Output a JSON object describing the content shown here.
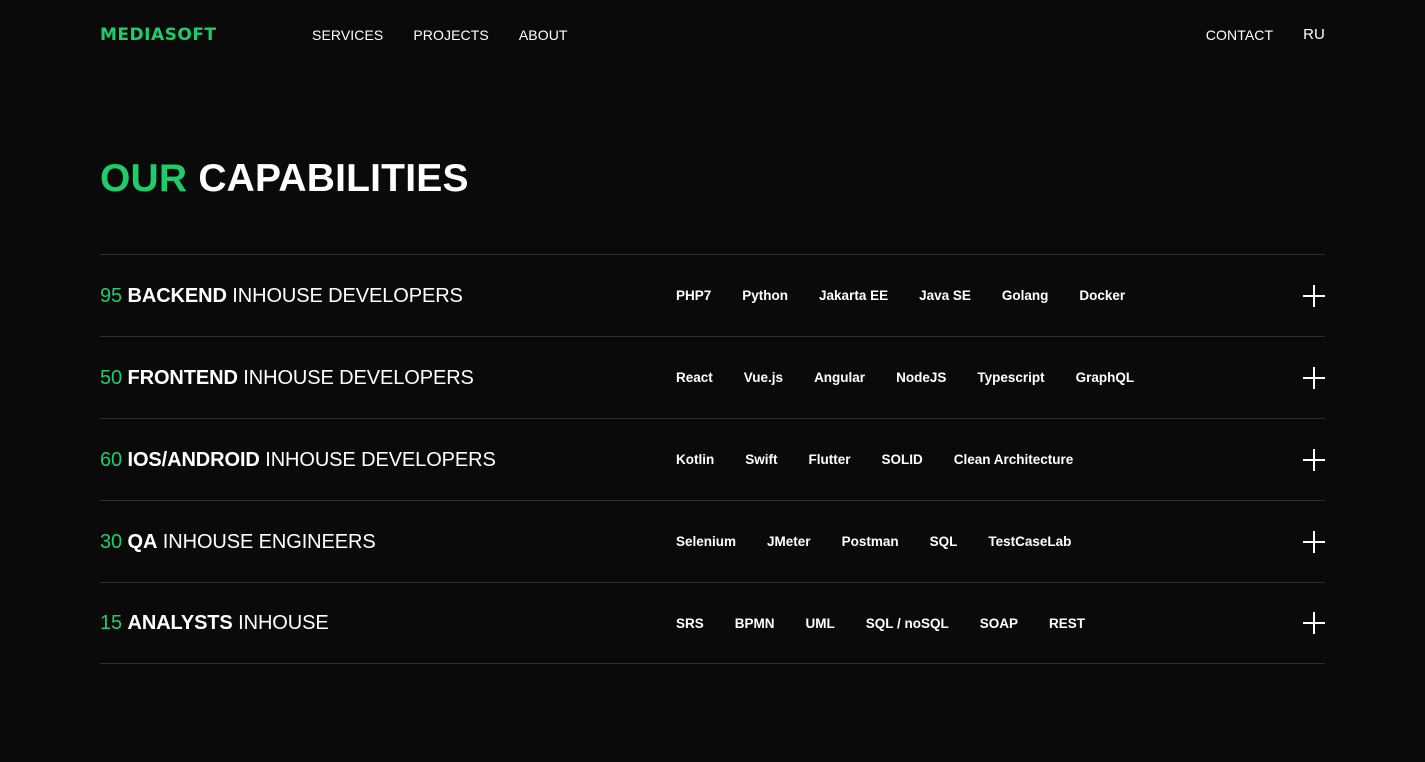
{
  "header": {
    "logo": "MEDIASOFT",
    "nav": [
      "SERVICES",
      "PROJECTS",
      "ABOUT"
    ],
    "contact": "CONTACT",
    "lang": "RU"
  },
  "section": {
    "title_accent": "OUR",
    "title_rest": "CAPABILITIES"
  },
  "capabilities": [
    {
      "count": "95",
      "bold": "BACKEND",
      "rest": "INHOUSE DEVELOPERS",
      "tags": [
        "PHP7",
        "Python",
        "Jakarta EE",
        "Java SE",
        "Golang",
        "Docker"
      ]
    },
    {
      "count": "50",
      "bold": "FRONTEND",
      "rest": "INHOUSE DEVELOPERS",
      "tags": [
        "React",
        "Vue.js",
        "Angular",
        "NodeJS",
        "Typescript",
        "GraphQL"
      ]
    },
    {
      "count": "60",
      "bold": "IOS/ANDROID",
      "rest": "INHOUSE DEVELOPERS",
      "tags": [
        "Kotlin",
        "Swift",
        "Flutter",
        "SOLID",
        "Clean Architecture"
      ]
    },
    {
      "count": "30",
      "bold": "QA",
      "rest": "INHOUSE ENGINEERS",
      "tags": [
        "Selenium",
        "JMeter",
        "Postman",
        "SQL",
        "TestCaseLab"
      ]
    },
    {
      "count": "15",
      "bold": "ANALYSTS",
      "rest": "INHOUSE",
      "tags": [
        "SRS",
        "BPMN",
        "UML",
        "SQL / noSQL",
        "SOAP",
        "REST"
      ]
    }
  ],
  "colors": {
    "accent": "#1fcc6a",
    "background": "#0a0a0a",
    "divider": "#2f2f2f"
  },
  "icons": {
    "expand": "plus-icon"
  }
}
